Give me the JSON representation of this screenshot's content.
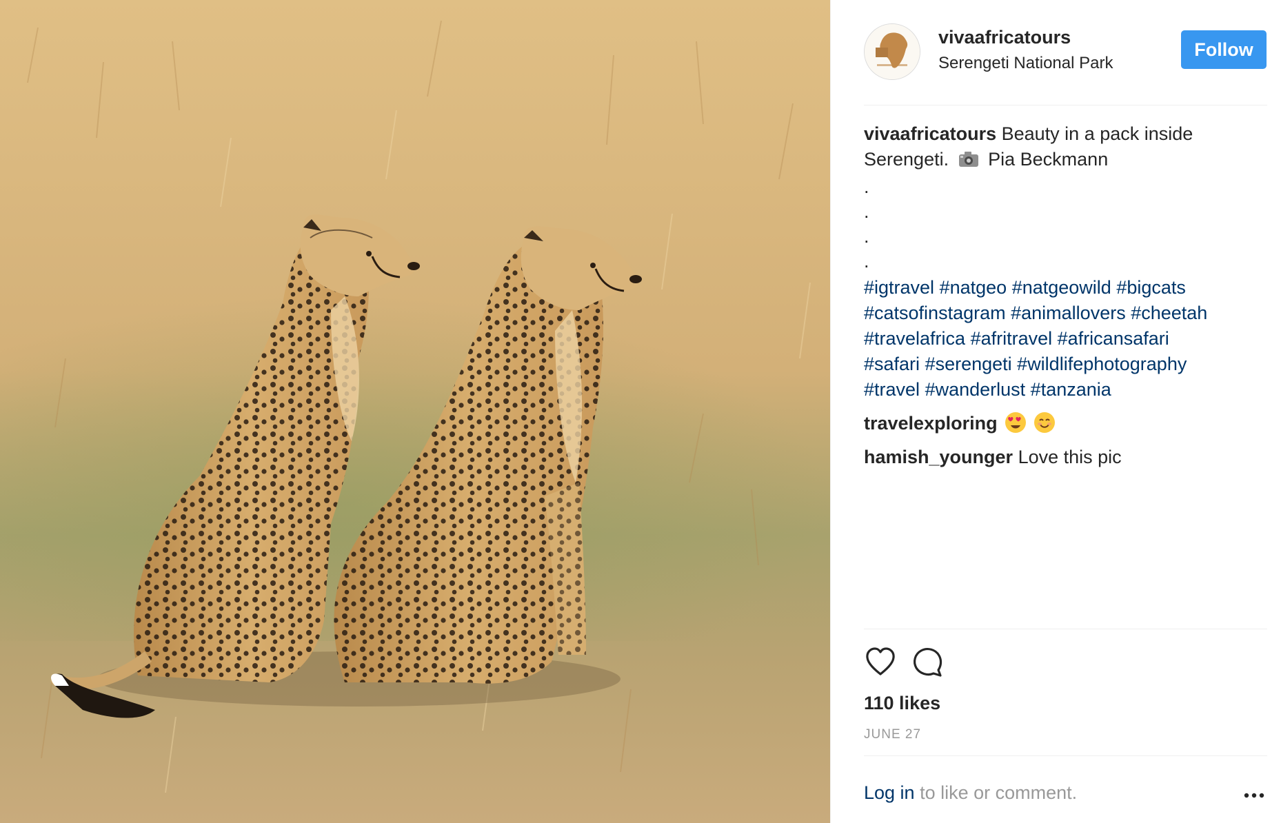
{
  "post": {
    "photo_alt": "Two cheetahs sitting in golden grass",
    "header": {
      "username": "vivaafricatours",
      "location": "Serengeti National Park",
      "follow_label": "Follow"
    },
    "caption": {
      "username": "vivaafricatours",
      "text_line1": "Beauty in a pack inside",
      "text_line2a": "Serengeti.",
      "text_line2b": "Pia Beckmann",
      "dots": [
        ".",
        ".",
        ".",
        "."
      ],
      "hashtags": [
        "#igtravel",
        "#natgeo",
        "#natgeowild",
        "#bigcats",
        "#catsofinstagram",
        "#animallovers",
        "#cheetah",
        "#travelafrica",
        "#afritravel",
        "#africansafari",
        "#safari",
        "#serengeti",
        "#wildlifephotography",
        "#travel",
        "#wanderlust",
        "#tanzania"
      ]
    },
    "comments": [
      {
        "username": "travelexploring",
        "text": "",
        "emojis": [
          "heart-eyes-emoji",
          "smiling-emoji"
        ]
      },
      {
        "username": "hamish_younger",
        "text": "Love this pic"
      }
    ],
    "likes_text": "110 likes",
    "date_text": "JUNE 27",
    "login": {
      "link_text": "Log in",
      "rest_text": " to like or comment."
    },
    "icons": {
      "like": "heart-icon",
      "comment": "comment-icon",
      "more": "more-options-icon",
      "camera": "camera-icon"
    }
  },
  "colors": {
    "follow_bg": "#3897f0",
    "link": "#003569",
    "muted": "#999999",
    "text": "#262626",
    "divider": "#efefef"
  }
}
